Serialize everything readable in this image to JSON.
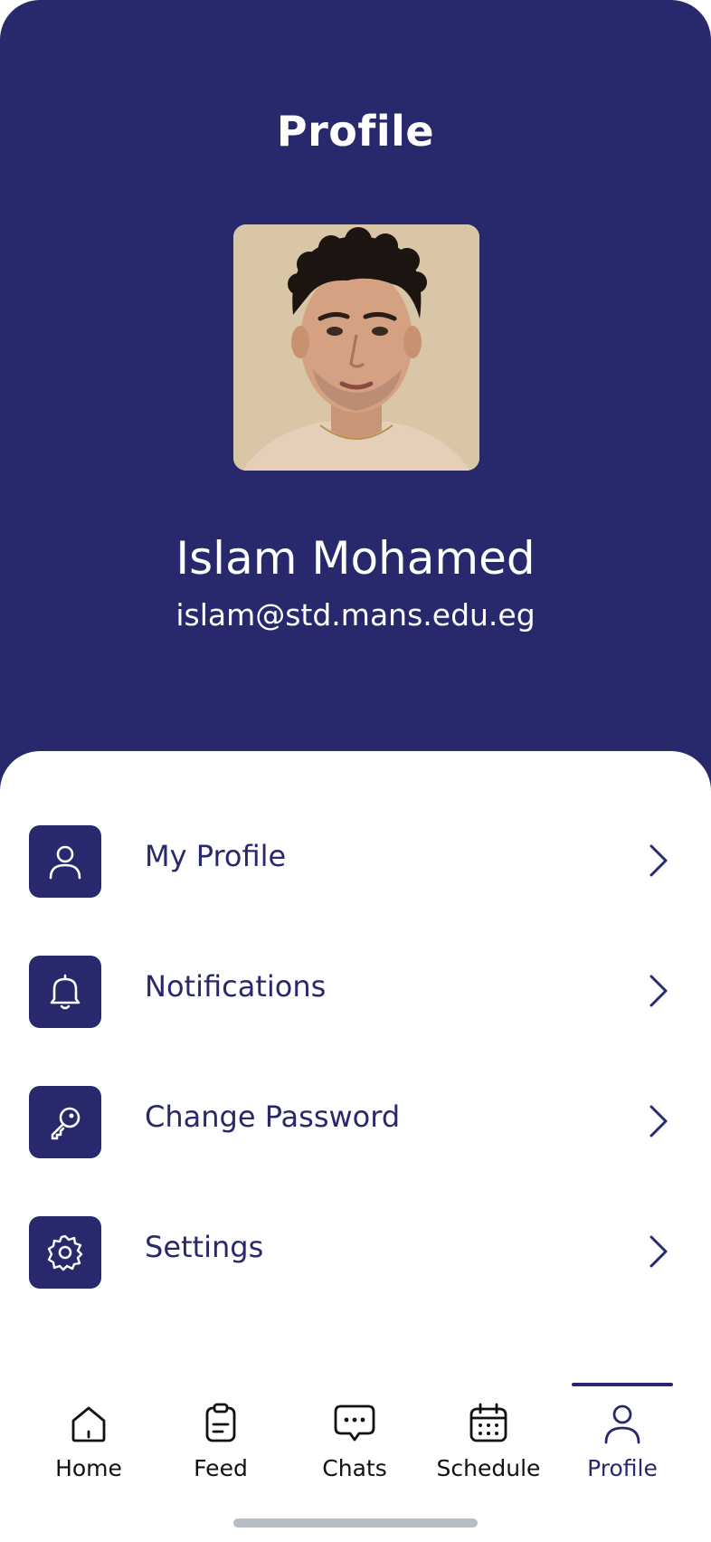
{
  "header": {
    "title": "Profile",
    "background_color": "#27296c",
    "user_name": "Islam Mohamed",
    "user_email": "islam@std.mans.edu.eg",
    "avatar_icon": "avatar-photo"
  },
  "menu": {
    "items": [
      {
        "label": "My Profile",
        "icon": "user-icon"
      },
      {
        "label": "Notifications",
        "icon": "bell-icon"
      },
      {
        "label": "Change Password",
        "icon": "key-icon"
      },
      {
        "label": "Settings",
        "icon": "gear-icon"
      }
    ],
    "accent_color": "#27296c"
  },
  "bottom_nav": {
    "items": [
      {
        "label": "Home",
        "icon": "home-icon",
        "active": false
      },
      {
        "label": "Feed",
        "icon": "clipboard-icon",
        "active": false
      },
      {
        "label": "Chats",
        "icon": "chat-bubble-icon",
        "active": false
      },
      {
        "label": "Schedule",
        "icon": "calendar-icon",
        "active": false
      },
      {
        "label": "Profile",
        "icon": "user-icon",
        "active": true
      }
    ],
    "active_color": "#27296c"
  }
}
